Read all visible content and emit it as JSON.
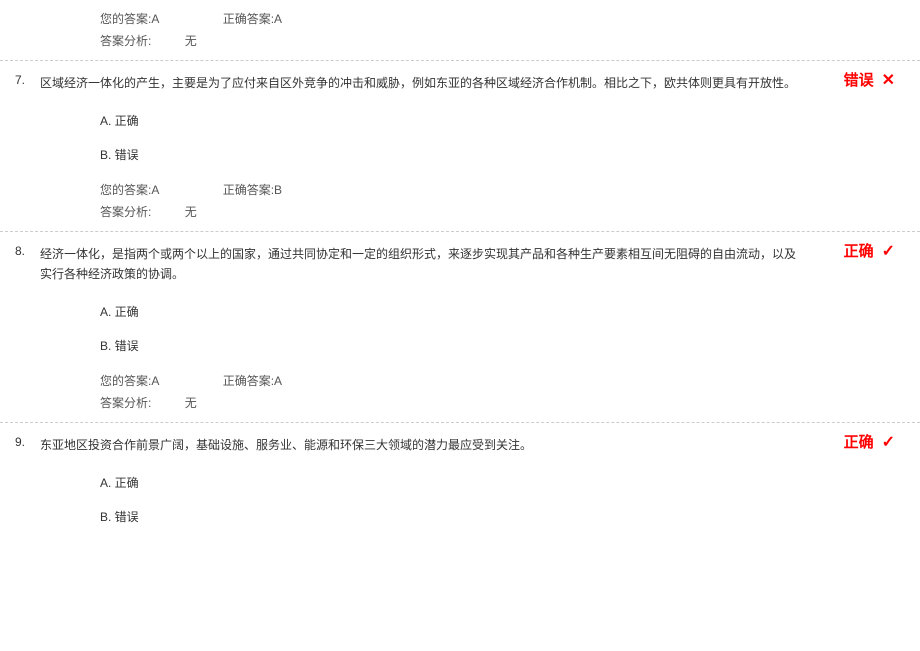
{
  "labels": {
    "your_answer": "您的答案:",
    "correct_answer": "正确答案:",
    "analysis": "答案分析:",
    "analysis_none": "无",
    "result_wrong": "错误",
    "result_correct": "正确"
  },
  "prev_footer": {
    "your_answer": "A",
    "correct_answer": "A"
  },
  "questions": [
    {
      "number": "7.",
      "text": "区域经济一体化的产生，主要是为了应付来自区外竞争的冲击和威胁，例如东亚的各种区域经济合作机制。相比之下，欧共体则更具有开放性。",
      "options": [
        {
          "label": "A. 正确"
        },
        {
          "label": "B. 错误"
        }
      ],
      "your_answer": "A",
      "correct_answer": "B",
      "result": "wrong"
    },
    {
      "number": "8.",
      "text": "经济一体化，是指两个或两个以上的国家，通过共同协定和一定的组织形式，来逐步实现其产品和各种生产要素相互间无阻碍的自由流动，以及实行各种经济政策的协调。",
      "options": [
        {
          "label": "A. 正确"
        },
        {
          "label": "B. 错误"
        }
      ],
      "your_answer": "A",
      "correct_answer": "A",
      "result": "correct"
    },
    {
      "number": "9.",
      "text": "东亚地区投资合作前景广阔，基础设施、服务业、能源和环保三大领域的潜力最应受到关注。",
      "options": [
        {
          "label": "A. 正确"
        },
        {
          "label": "B. 错误"
        }
      ],
      "result": "correct"
    }
  ]
}
